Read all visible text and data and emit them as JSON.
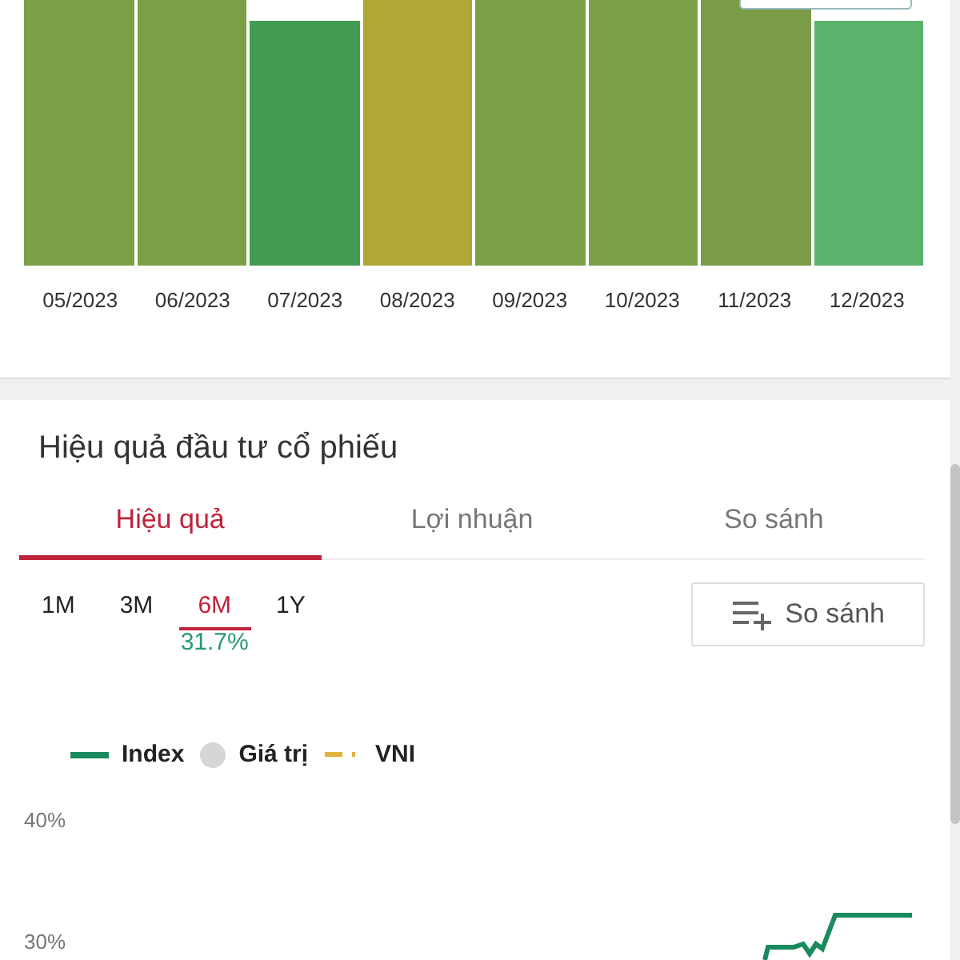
{
  "bar_chart": {
    "bars": [
      {
        "label": "05/2023",
        "color": "#7ba146",
        "kind": "tall"
      },
      {
        "label": "06/2023",
        "color": "#7ba146",
        "kind": "tall"
      },
      {
        "label": "07/2023",
        "color": "#439b51",
        "kind": "short"
      },
      {
        "label": "08/2023",
        "color": "#b0a834",
        "kind": "tall"
      },
      {
        "label": "09/2023",
        "color": "#7ba146",
        "kind": "tall"
      },
      {
        "label": "10/2023",
        "color": "#7ba146",
        "kind": "tall"
      },
      {
        "label": "11/2023",
        "color": "#7a9c46",
        "kind": "tall"
      },
      {
        "label": "12/2023",
        "color": "#5ab36a",
        "kind": "short"
      }
    ]
  },
  "performance": {
    "title": "Hiệu quả đầu tư cổ phiếu",
    "tabs": [
      {
        "label": "Hiệu quả",
        "selected": true
      },
      {
        "label": "Lợi nhuận",
        "selected": false
      },
      {
        "label": "So sánh",
        "selected": false
      }
    ],
    "periods": [
      {
        "label": "1M",
        "selected": false
      },
      {
        "label": "3M",
        "selected": false
      },
      {
        "label": "6M",
        "selected": true,
        "return": "31.7%"
      },
      {
        "label": "1Y",
        "selected": false
      }
    ],
    "compare_button": "So sánh",
    "legend": [
      {
        "kind": "line",
        "label": "Index",
        "color": "#198a5e"
      },
      {
        "kind": "dot",
        "label": "Giá trị",
        "color": "#d6d6d6"
      },
      {
        "kind": "dash",
        "label": "VNI",
        "color": "#e0b43a"
      }
    ],
    "y_labels": [
      "40%",
      "30%"
    ]
  }
}
